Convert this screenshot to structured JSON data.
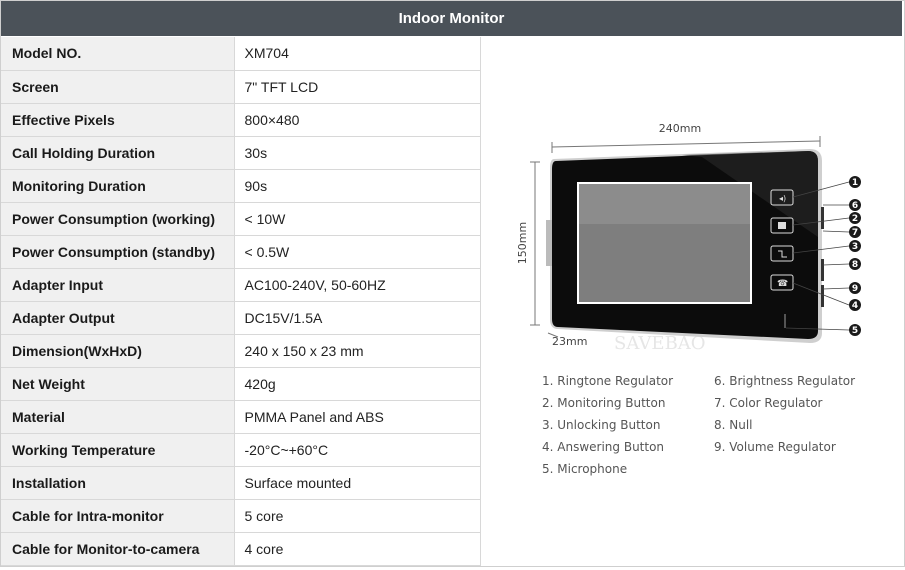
{
  "header": {
    "title": "Indoor Monitor"
  },
  "specs": [
    {
      "key": "Model NO.",
      "value": "XM704"
    },
    {
      "key": "Screen",
      "value": "7\" TFT LCD"
    },
    {
      "key": "Effective Pixels",
      "value": "800×480"
    },
    {
      "key": "Call Holding Duration",
      "value": "30s"
    },
    {
      "key": "Monitoring Duration",
      "value": "90s"
    },
    {
      "key": "Power Consumption (working)",
      "value": "< 10W"
    },
    {
      "key": "Power Consumption (standby)",
      "value": "< 0.5W"
    },
    {
      "key": "Adapter Input",
      "value": "AC100-240V, 50-60HZ"
    },
    {
      "key": "Adapter Output",
      "value": "DC15V/1.5A"
    },
    {
      "key": "Dimension(WxHxD)",
      "value": "240 x 150 x 23 mm"
    },
    {
      "key": "Net Weight",
      "value": "420g"
    },
    {
      "key": "Material",
      "value": "PMMA Panel and ABS"
    },
    {
      "key": "Working Temperature",
      "value": "-20°C~+60°C"
    },
    {
      "key": "Installation",
      "value": "Surface mounted"
    },
    {
      "key": "Cable for Intra-monitor",
      "value": "5 core"
    },
    {
      "key": "Cable for Monitor-to-camera",
      "value": "4 core"
    }
  ],
  "diagram": {
    "width_label": "240mm",
    "height_label": "150mm",
    "depth_label": "23mm",
    "watermark": "SAVEBAO",
    "callouts": [
      "1",
      "6",
      "2",
      "7",
      "3",
      "8",
      "9",
      "4",
      "5"
    ]
  },
  "legend": {
    "col1": [
      "1. Ringtone Regulator",
      "2. Monitoring Button",
      "3. Unlocking Button",
      "4. Answering Button",
      "5. Microphone"
    ],
    "col2": [
      "6. Brightness Regulator",
      "7. Color Regulator",
      "8. Null",
      "9. Volume Regulator"
    ]
  }
}
